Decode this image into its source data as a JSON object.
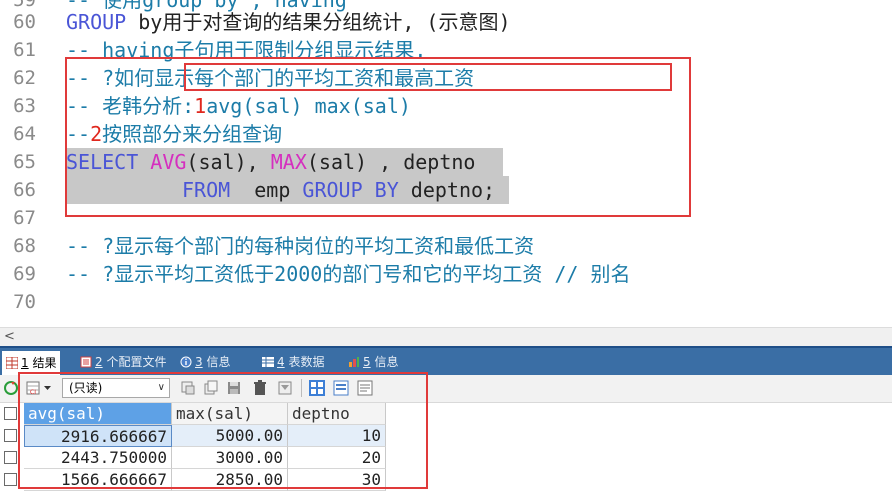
{
  "editor": {
    "lines": [
      {
        "n": "59",
        "text": "-- 使用group by , having"
      },
      {
        "n": "60",
        "a": "GROUP",
        "b": " by用于对查询的结果分组统计, (示意图)"
      },
      {
        "n": "61",
        "text": "-- having子句用于限制分组显示结果."
      },
      {
        "n": "62",
        "a": "-- ?如何",
        "b": "显示每个部门的平均工资和最高工资"
      },
      {
        "n": "63",
        "a": "-- 老韩分析:",
        "b": "1",
        "c": "avg(sal) max(sal)"
      },
      {
        "n": "64",
        "a": "--",
        "b": "2",
        "c": "按照部分来分组查询"
      },
      {
        "n": "65",
        "select": "SELECT",
        "avg": "AVG",
        "p1": "(sal)",
        "comma": ", ",
        "max": "MAX",
        "p2": "(sal)",
        "rest": " , deptno"
      },
      {
        "n": "66",
        "from": "FROM",
        "emp": "  emp ",
        "group": "GROUP",
        "by": " BY",
        "tail": " deptno;"
      },
      {
        "n": "67"
      },
      {
        "n": "68",
        "text": "-- ?显示每个部门的每种岗位的平均工资和最低工资"
      },
      {
        "n": "69",
        "text": "-- ?显示平均工资低于2000的部门号和它的平均工资 // 别名"
      },
      {
        "n": "70"
      }
    ]
  },
  "scroll": {
    "left_arrow": "<"
  },
  "tabs": [
    {
      "num": "1",
      "label": " 结果"
    },
    {
      "num": "2",
      "label": " 个配置文件"
    },
    {
      "num": "3",
      "label": " 信息"
    },
    {
      "num": "4",
      "label": " 表数据"
    },
    {
      "num": "5",
      "label": " 信息"
    }
  ],
  "toolbar": {
    "mode": "(只读)",
    "caret": "∨"
  },
  "table": {
    "columns": [
      "avg(sal)",
      "max(sal)",
      "deptno"
    ],
    "rows": [
      [
        "2916.666667",
        "5000.00",
        "10"
      ],
      [
        "2443.750000",
        "3000.00",
        "20"
      ],
      [
        "1566.666667",
        "2850.00",
        "30"
      ]
    ]
  },
  "colors": {
    "accent_red": "#e03a3a",
    "tab_bar": "#3a6ea5",
    "selection": "#c8c8c8",
    "header_selected": "#5ea1e6"
  }
}
